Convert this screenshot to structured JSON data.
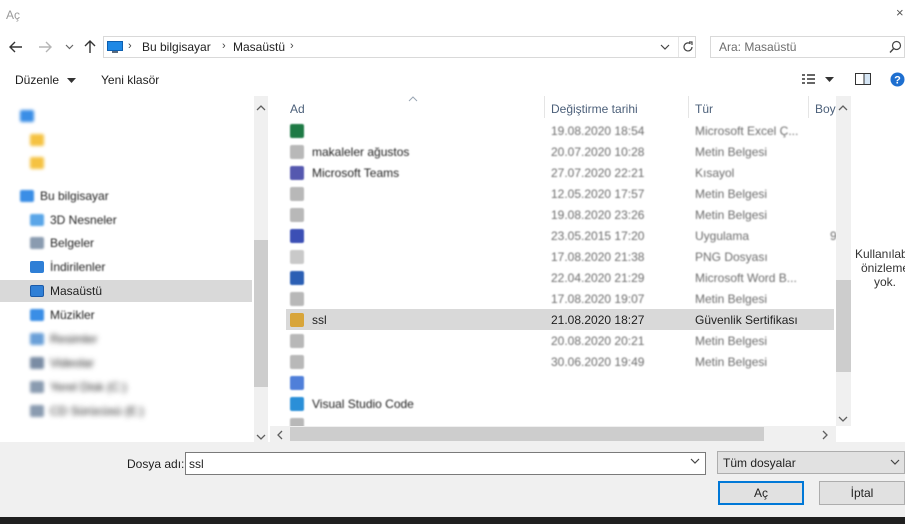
{
  "window": {
    "title": "Aç"
  },
  "address": {
    "crumbs": [
      "Bu bilgisayar",
      "Masaüstü"
    ],
    "search_placeholder": "Ara: Masaüstü"
  },
  "toolbar": {
    "organize_label": "Düzenle",
    "new_folder_label": "Yeni klasör"
  },
  "nav": {
    "items": [
      {
        "label": "",
        "icon": "cloud-icon",
        "color": "#3a8ee6"
      },
      {
        "label": "",
        "icon": "folder-icon",
        "color": "#f5c242"
      },
      {
        "label": "",
        "icon": "folder-icon",
        "color": "#f5c242"
      },
      {
        "label": "Bu bilgisayar",
        "icon": "computer-icon",
        "color": "#3a8ee6"
      },
      {
        "label": "3D Nesneler",
        "icon": "cube-icon",
        "color": "#5aa6e8"
      },
      {
        "label": "Belgeler",
        "icon": "document-icon",
        "color": "#8a9bb0"
      },
      {
        "label": "İndirilenler",
        "icon": "download-icon",
        "color": "#2f7fd6"
      },
      {
        "label": "Masaüstü",
        "icon": "desktop-icon",
        "color": "#2f7fd6"
      },
      {
        "label": "Müzikler",
        "icon": "music-icon",
        "color": "#3a8ee6"
      },
      {
        "label": "Resimler",
        "icon": "picture-icon",
        "color": "#6aa0d8"
      },
      {
        "label": "Videolar",
        "icon": "video-icon",
        "color": "#7a8ca4"
      },
      {
        "label": "Yerel Disk (C:)",
        "icon": "drive-icon",
        "color": "#8a9bb0"
      },
      {
        "label": "CD Sürücüsü (E:)",
        "icon": "disc-icon",
        "color": "#8a9bb0"
      }
    ]
  },
  "columns": {
    "name": "Ad",
    "date": "Değiştirme tarihi",
    "type": "Tür",
    "size": "Boy"
  },
  "files": [
    {
      "name": "",
      "date": "19.08.2020 18:54",
      "type": "Microsoft Excel Ç...",
      "icon": "excel-icon",
      "color": "#1e7a45",
      "size": ""
    },
    {
      "name": "makaleler ağustos",
      "date": "20.07.2020 10:28",
      "type": "Metin Belgesi",
      "icon": "text-file-icon",
      "color": "#b8b8b8",
      "size": ""
    },
    {
      "name": "Microsoft Teams",
      "date": "27.07.2020 22:21",
      "type": "Kısayol",
      "icon": "teams-icon",
      "color": "#5558af",
      "size": ""
    },
    {
      "name": "",
      "date": "12.05.2020 17:57",
      "type": "Metin Belgesi",
      "icon": "text-file-icon",
      "color": "#b8b8b8",
      "size": ""
    },
    {
      "name": "",
      "date": "19.08.2020 23:26",
      "type": "Metin Belgesi",
      "icon": "text-file-icon",
      "color": "#b8b8b8",
      "size": ""
    },
    {
      "name": "",
      "date": "23.05.2015 17:20",
      "type": "Uygulama",
      "icon": "app-icon",
      "color": "#3b4fb5",
      "size": "9"
    },
    {
      "name": "",
      "date": "17.08.2020 21:38",
      "type": "PNG Dosyası",
      "icon": "image-file-icon",
      "color": "#c9c9c9",
      "size": ""
    },
    {
      "name": "",
      "date": "22.04.2020 21:29",
      "type": "Microsoft Word B...",
      "icon": "word-icon",
      "color": "#2b5fb4",
      "size": ""
    },
    {
      "name": "",
      "date": "17.08.2020 19:07",
      "type": "Metin Belgesi",
      "icon": "text-file-icon",
      "color": "#b8b8b8",
      "size": ""
    },
    {
      "name": "ssl",
      "date": "21.08.2020 18:27",
      "type": "Güvenlik Sertifikası",
      "icon": "certificate-icon",
      "color": "#d8a53a",
      "size": ""
    },
    {
      "name": "",
      "date": "20.08.2020 20:21",
      "type": "Metin Belgesi",
      "icon": "text-file-icon",
      "color": "#b8b8b8",
      "size": ""
    },
    {
      "name": "",
      "date": "30.06.2020 19:49",
      "type": "Metin Belgesi",
      "icon": "text-file-icon",
      "color": "#b8b8b8",
      "size": ""
    },
    {
      "name": "",
      "date": "",
      "type": "",
      "icon": "shortcut-icon",
      "color": "#4f7fd9",
      "size": ""
    },
    {
      "name": "Visual Studio Code",
      "date": "",
      "type": "",
      "icon": "vscode-icon",
      "color": "#2a8fd8",
      "size": ""
    },
    {
      "name": "",
      "date": "",
      "type": "",
      "icon": "text-file-icon",
      "color": "#b8b8b8",
      "size": ""
    }
  ],
  "preview": {
    "message": "Kullanılabilir önizleme yok."
  },
  "bottom": {
    "filename_label": "Dosya adı:",
    "filename_value": "ssl",
    "filetype_value": "Tüm dosyalar",
    "open_label": "Aç",
    "cancel_label": "İptal"
  }
}
